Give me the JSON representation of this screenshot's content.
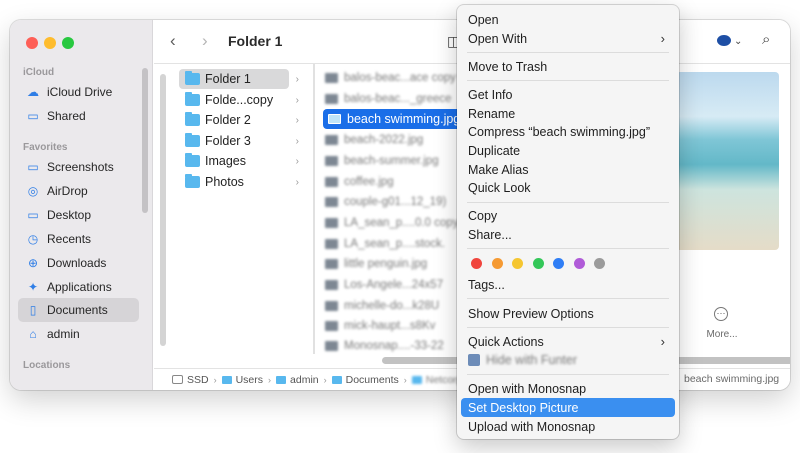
{
  "window": {
    "title": "Folder 1"
  },
  "sidebar": {
    "sections": [
      {
        "heading": "iCloud",
        "items": [
          {
            "label": "iCloud Drive",
            "icon": "cloud-icon"
          },
          {
            "label": "Shared",
            "icon": "shared-folder-icon"
          }
        ]
      },
      {
        "heading": "Favorites",
        "items": [
          {
            "label": "Screenshots",
            "icon": "folder-icon"
          },
          {
            "label": "AirDrop",
            "icon": "airdrop-icon"
          },
          {
            "label": "Desktop",
            "icon": "desktop-icon"
          },
          {
            "label": "Recents",
            "icon": "clock-icon"
          },
          {
            "label": "Downloads",
            "icon": "download-icon"
          },
          {
            "label": "Applications",
            "icon": "applications-icon"
          },
          {
            "label": "Documents",
            "icon": "document-icon",
            "selected": true
          },
          {
            "label": "admin",
            "icon": "home-icon"
          }
        ]
      },
      {
        "heading": "Locations",
        "items": []
      }
    ]
  },
  "column1": {
    "items": [
      {
        "label": "Folder 1",
        "selected": true
      },
      {
        "label": "Folde...copy"
      },
      {
        "label": "Folder 2"
      },
      {
        "label": "Folder 3"
      },
      {
        "label": "Images"
      },
      {
        "label": "Photos"
      }
    ]
  },
  "column2": {
    "items": [
      {
        "label": "balos-beac...ace copy",
        "blurred": true
      },
      {
        "label": "balos-beac..._greece",
        "blurred": true
      },
      {
        "label": "beach swimming.jpg",
        "selected": true
      },
      {
        "label": "beach-2022.jpg",
        "blurred": true
      },
      {
        "label": "beach-summer.jpg",
        "blurred": true
      },
      {
        "label": "coffee.jpg",
        "blurred": true
      },
      {
        "label": "couple-g01...12_19)",
        "blurred": true
      },
      {
        "label": "LA_sean_p....0.0 copy",
        "blurred": true
      },
      {
        "label": "LA_sean_p....stock.",
        "blurred": true
      },
      {
        "label": "little penguin.jpg",
        "blurred": true
      },
      {
        "label": "Los-Angele...24x57",
        "blurred": true
      },
      {
        "label": "michelle-do...k28U",
        "blurred": true
      },
      {
        "label": "mick-haupt...s8Kv",
        "blurred": true
      },
      {
        "label": "Monosnap....-33-22",
        "blurred": true
      }
    ]
  },
  "preview": {
    "more_label": "More..."
  },
  "pathbar": {
    "segments": [
      "SSD",
      "Users",
      "admin",
      "Documents",
      "Netcorp"
    ],
    "file": "beach swimming.jpg"
  },
  "context_menu": {
    "open": "Open",
    "open_with": "Open With",
    "move_to_trash": "Move to Trash",
    "get_info": "Get Info",
    "rename": "Rename",
    "compress": "Compress “beach swimming.jpg”",
    "duplicate": "Duplicate",
    "make_alias": "Make Alias",
    "quick_look": "Quick Look",
    "copy": "Copy",
    "share": "Share...",
    "tags": "Tags...",
    "show_preview_options": "Show Preview Options",
    "quick_actions": "Quick Actions",
    "hide_with_funter": "Hide with Funter",
    "open_with_monosnap": "Open with Monosnap",
    "set_desktop_picture": "Set Desktop Picture",
    "upload_with_monosnap": "Upload with Monosnap",
    "tag_colors": [
      "#f0453d",
      "#f59a33",
      "#f5c631",
      "#34c759",
      "#2f7ef5",
      "#b05bd8",
      "#9b9b9b"
    ]
  }
}
